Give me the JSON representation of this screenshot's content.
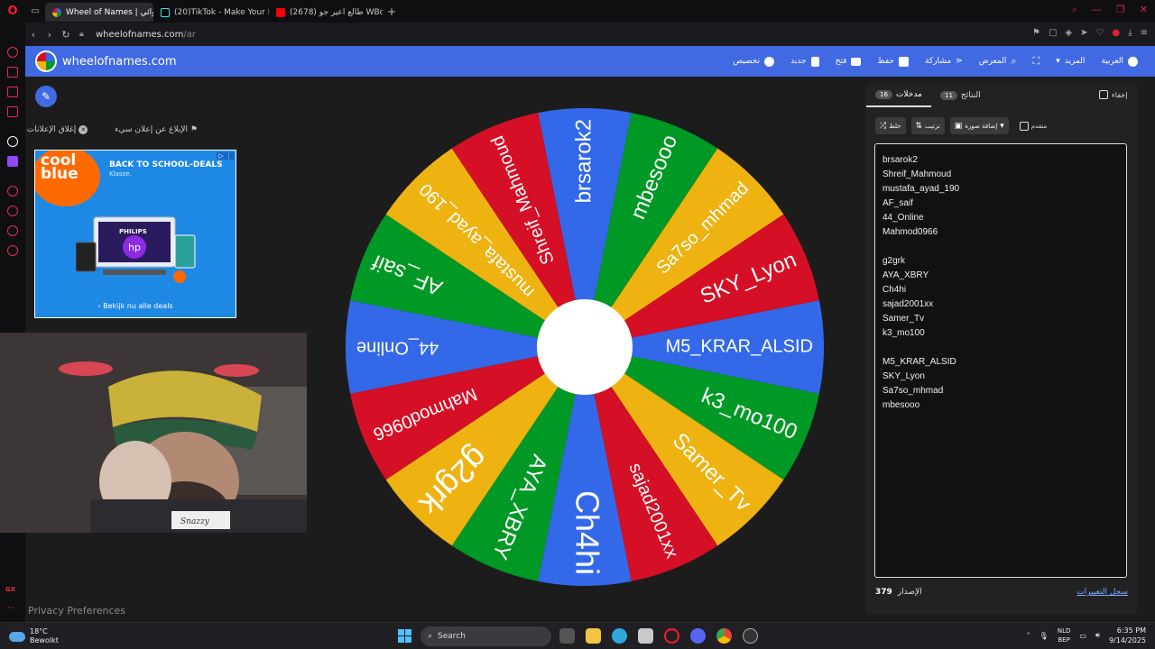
{
  "browser": {
    "tabs": [
      {
        "label": "Wheel of Names | عشوائي",
        "active": true,
        "icon": "wheel-favicon"
      },
      {
        "label": "(20)TikTok - Make Your D",
        "active": false,
        "icon": "tiktok-favicon"
      },
      {
        "label": "(2678) طالع اعير جو WBoY",
        "active": false,
        "icon": "youtube-favicon"
      }
    ],
    "url_host": "wheelofnames.com",
    "url_path": "/ar",
    "new_tab_label": "+"
  },
  "header": {
    "site_name": "wheelofnames.com",
    "menu": [
      {
        "label": "تخصيص",
        "icon": "palette-icon"
      },
      {
        "label": "جديد",
        "icon": "new-file-icon"
      },
      {
        "label": "فتح",
        "icon": "folder-icon"
      },
      {
        "label": "حفظ",
        "icon": "save-icon"
      },
      {
        "label": "مشاركة",
        "icon": "share-icon"
      },
      {
        "label": "المعرض",
        "icon": "search-icon"
      },
      {
        "label": "",
        "icon": "fullscreen-icon"
      },
      {
        "label": "المزيد",
        "icon": "chevron-down-icon"
      },
      {
        "label": "العربية",
        "icon": "globe-icon"
      }
    ]
  },
  "ads": {
    "report_label": "الإبلاغ عن إعلان سيء",
    "close_label": "إغلاق الإعلانات",
    "banner": {
      "brand_line1": "cool",
      "brand_line2": "blue",
      "title": "BACK TO SCHOOL-DEALS",
      "subtitle": "Klasse.",
      "product_label": "PHILIPS",
      "cta": "› Bekijk nu alle deals"
    }
  },
  "privacy_label": "Privacy Preferences",
  "wheel": {
    "colors": [
      "#3369e8",
      "#009925",
      "#eeb211",
      "#d50f25"
    ],
    "segments": [
      "brsarok2",
      "mbesooo",
      "Sa7so_mhmad",
      "SKY_Lyon",
      "M5_KRAR_ALSID",
      "k3_mo100",
      "Samer_Tv",
      "sajad2001xx",
      "Ch4hi",
      "AYA_XBRY",
      "g2grk",
      "Mahmod0966",
      "44_Online",
      "AF_saif",
      "mustafa_ayad_190",
      "Shreif_Mahmoud"
    ]
  },
  "panel": {
    "tab_entries": "مدخلات",
    "tab_entries_count": "16",
    "tab_results": "النتائج",
    "tab_results_count": "11",
    "hide_label": "إخفاء",
    "shuffle_label": "خلط",
    "sort_label": "ترتيب",
    "add_image_label": "إضافة صورة",
    "advanced_label": "متقدم",
    "entries": [
      "brsarok2",
      "Shreif_Mahmoud",
      "mustafa_ayad_190",
      "AF_saif",
      "44_Online",
      "Mahmod0966",
      "",
      "g2grk",
      "AYA_XBRY",
      "Ch4hi",
      "sajad2001xx",
      "Samer_Tv",
      "k3_mo100",
      "",
      "M5_KRAR_ALSID",
      "SKY_Lyon",
      "Sa7so_mhmad",
      "mbesooo"
    ],
    "version_label": "الإصدار",
    "version_number": "379",
    "changelog_label": "سجل التغييرات"
  },
  "taskbar": {
    "temperature": "18°C",
    "weather": "Bewolkt",
    "search_placeholder": "Search",
    "lang_top": "NLD",
    "lang_bottom": "BEP",
    "time": "6:35 PM",
    "date": "9/14/2025"
  }
}
